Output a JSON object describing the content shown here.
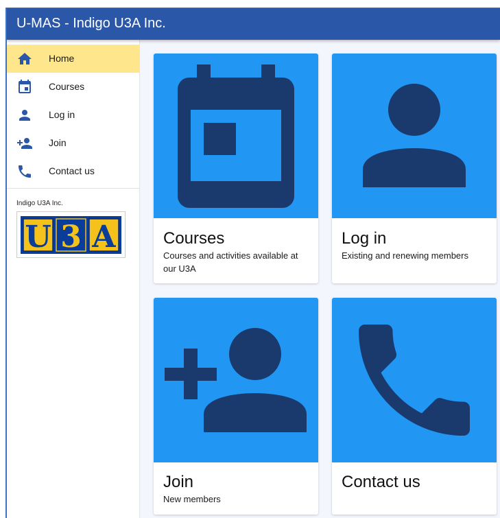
{
  "appbar": {
    "title": "U-MAS - Indigo U3A Inc."
  },
  "sidebar": {
    "items": [
      {
        "label": "Home",
        "icon": "home-icon",
        "active": true
      },
      {
        "label": "Courses",
        "icon": "calendar-icon",
        "active": false
      },
      {
        "label": "Log in",
        "icon": "person-icon",
        "active": false
      },
      {
        "label": "Join",
        "icon": "person-add-icon",
        "active": false
      },
      {
        "label": "Contact us",
        "icon": "phone-icon",
        "active": false
      }
    ],
    "org_name": "Indigo U3A Inc.",
    "logo_text": "U3A"
  },
  "cards": [
    {
      "title": "Courses",
      "description": "Courses and activities available at our U3A",
      "icon": "calendar-icon"
    },
    {
      "title": "Log in",
      "description": "Existing and renewing members",
      "icon": "person-icon"
    },
    {
      "title": "Join",
      "description": "New members",
      "icon": "person-add-icon"
    },
    {
      "title": "Contact us",
      "description": "",
      "icon": "phone-icon"
    }
  ],
  "colors": {
    "appbar": "#2a57a7",
    "active_nav": "#fde68c",
    "card_media": "#2196f3",
    "icon_dark": "#1a3a6e",
    "nav_icon": "#2a57a7"
  }
}
